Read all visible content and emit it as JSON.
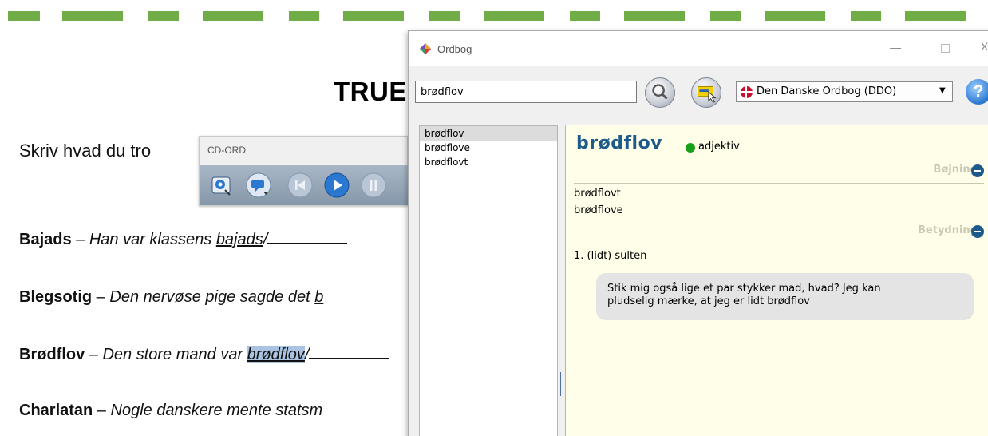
{
  "document": {
    "title": "TRUE",
    "prompt": "Skriv hvad du tro",
    "lines": [
      {
        "term": "Bajads",
        "dash": " – ",
        "sentence_pre": "Han var klassens ",
        "word": "bajads",
        "slash": "/"
      },
      {
        "term": "Blegsotig",
        "dash": " – ",
        "sentence_pre": "Den nervøse pige sagde det ",
        "word": "b"
      },
      {
        "term": "Brødflov",
        "dash": " – ",
        "sentence_pre": "Den store mand var ",
        "word": "brødflov",
        "slash": "/"
      },
      {
        "term": "Charlatan",
        "dash": " – ",
        "sentence_pre": "Nogle danskere mente statsm"
      }
    ]
  },
  "cdord": {
    "title": "CD-ORD",
    "buttons": [
      "settings-icon",
      "speech-bubble-icon",
      "skip-back-icon",
      "play-icon",
      "pause-icon"
    ]
  },
  "ordbog": {
    "title": "Ordbog",
    "window_controls": {
      "minimize": "—",
      "close": "X"
    },
    "search_value": "brødflov",
    "dictionary": "Den Danske Ordbog (DDO)",
    "help_label": "?",
    "word_list": [
      "brødflov",
      "brødflove",
      "brødflovt"
    ],
    "selected_index": 0,
    "entry": {
      "headword": "brødflov",
      "part_of_speech": "adjektiv",
      "inflection_heading": "Bøjning",
      "inflections": [
        "brødflovt",
        "brødflove"
      ],
      "meaning_heading": "Betydning",
      "definition": "1. (lidt) sulten",
      "example_line1": "Stik mig også lige et par stykker mad, hvad? Jeg kan",
      "example_line2": "pludselig mærke, at jeg er lidt brødflov"
    }
  },
  "colors": {
    "dash_green": "#70ad47",
    "headword_blue": "#1d5a8c",
    "content_bg": "#fffee8",
    "pos_green": "#18a018",
    "selection_blue": "#a9c3e0"
  }
}
